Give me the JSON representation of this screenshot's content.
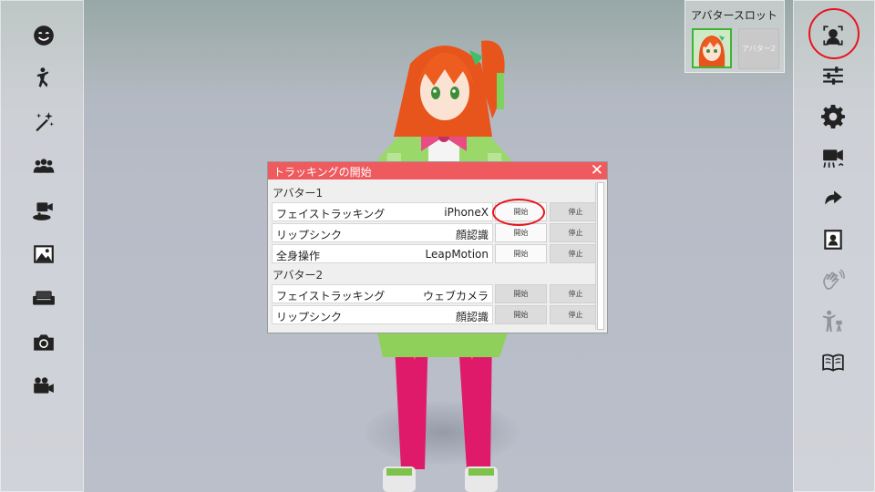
{
  "avatar_slot": {
    "title": "アバタースロット",
    "slot2_label": "アバター2"
  },
  "left_toolbar": [
    {
      "icon": "face-emotion-icon"
    },
    {
      "icon": "pose-icon"
    },
    {
      "icon": "magic-wand-icon"
    },
    {
      "icon": "group-icon"
    },
    {
      "icon": "camera-stage-icon"
    },
    {
      "icon": "image-icon"
    },
    {
      "icon": "sofa-icon"
    },
    {
      "icon": "camera-icon"
    },
    {
      "icon": "video-camera-icon"
    }
  ],
  "right_toolbar": [
    {
      "icon": "face-tracking-icon",
      "highlighted": true
    },
    {
      "icon": "sliders-icon"
    },
    {
      "icon": "settings-icon"
    },
    {
      "icon": "record-camera-icon"
    },
    {
      "icon": "redo-icon"
    },
    {
      "icon": "portrait-icon"
    },
    {
      "icon": "hand-wave-icon",
      "disabled": true
    },
    {
      "icon": "person-camera-icon",
      "disabled": true
    },
    {
      "icon": "book-icon"
    }
  ],
  "tracking_dialog": {
    "title": "トラッキングの開始",
    "close": "✕",
    "sections": [
      {
        "label": "アバター1",
        "rows": [
          {
            "name": "フェイストラッキング",
            "device": "iPhoneX",
            "start": "開始",
            "stop": "停止"
          },
          {
            "name": "リップシンク",
            "device": "顔認識",
            "start": "開始",
            "stop": "停止"
          },
          {
            "name": "全身操作",
            "device": "LeapMotion",
            "start": "開始",
            "stop": "停止"
          }
        ]
      },
      {
        "label": "アバター2",
        "rows": [
          {
            "name": "フェイストラッキング",
            "device": "ウェブカメラ",
            "start": "開始",
            "stop": "停止"
          },
          {
            "name": "リップシンク",
            "device": "顔認識",
            "start": "開始",
            "stop": "停止"
          }
        ]
      }
    ]
  },
  "colors": {
    "dialog_header": "#ef5a5e",
    "highlight": "#e8141e",
    "slot_active": "#3fb536"
  }
}
